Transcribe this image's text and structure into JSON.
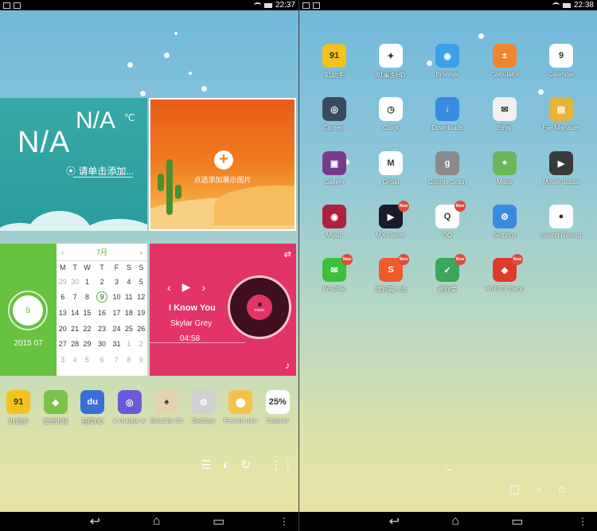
{
  "status_left": {
    "time": "22:37"
  },
  "status_right": {
    "time": "22:38"
  },
  "weather": {
    "temp_big": "N/A",
    "temp_small": "N/A",
    "unit": "℃",
    "location": "请单击添加..."
  },
  "image_widget": {
    "label": "点选添加展示图片"
  },
  "date_widget": {
    "day": "9",
    "year_month": "2015  07"
  },
  "calendar": {
    "month": "7月",
    "prev": "‹",
    "next": "›",
    "weekdays": [
      "M",
      "T",
      "W",
      "T",
      "F",
      "S",
      "S"
    ],
    "weeks": [
      [
        "29",
        "30",
        "1",
        "2",
        "3",
        "4",
        "5"
      ],
      [
        "6",
        "7",
        "8",
        "9",
        "10",
        "11",
        "12"
      ],
      [
        "13",
        "14",
        "15",
        "16",
        "17",
        "18",
        "19"
      ],
      [
        "20",
        "21",
        "22",
        "23",
        "24",
        "25",
        "26"
      ],
      [
        "27",
        "28",
        "29",
        "30",
        "31",
        "1",
        "2"
      ],
      [
        "3",
        "4",
        "5",
        "6",
        "7",
        "8",
        "9"
      ]
    ]
  },
  "music": {
    "title": "I Know You",
    "artist": "Skylar Grey",
    "time": "04:58",
    "disc_label": "music"
  },
  "dock": [
    {
      "label": "91助手",
      "color": "#f4c21c",
      "glyph": "91"
    },
    {
      "label": "安卓市场",
      "color": "#7cc24a",
      "glyph": "◆"
    },
    {
      "label": "百度HD",
      "color": "#3a6fd8",
      "glyph": "du"
    },
    {
      "label": "k change w",
      "color": "#6a5ad8",
      "glyph": "◎"
    },
    {
      "label": "Beautify Sh",
      "color": "#e4d3b0",
      "glyph": "♠"
    },
    {
      "label": "Settings",
      "color": "#d0d0d0",
      "glyph": "⚙"
    },
    {
      "label": "Recent runr",
      "color": "#f3c24a",
      "glyph": "⬤"
    },
    {
      "label": "Cleaner",
      "color": "#ffffff",
      "glyph": "25%"
    }
  ],
  "apps": [
    {
      "label": "91助手",
      "color": "#f4c21c",
      "glyph": "91",
      "new": false
    },
    {
      "label": "91桌面HD",
      "color": "#ffffff",
      "glyph": "✦",
      "new": false
    },
    {
      "label": "Browser",
      "color": "#3aa0e8",
      "glyph": "◉",
      "new": false
    },
    {
      "label": "Calculator",
      "color": "#f0862c",
      "glyph": "±",
      "new": false
    },
    {
      "label": "Calendar",
      "color": "#ffffff",
      "glyph": "9",
      "new": false
    },
    {
      "label": "Camera",
      "color": "#3a4a5c",
      "glyph": "◎",
      "new": false
    },
    {
      "label": "Clock",
      "color": "#ffffff",
      "glyph": "◷",
      "new": false
    },
    {
      "label": "Downloads",
      "color": "#3a8ae0",
      "glyph": "↓",
      "new": false
    },
    {
      "label": "Email",
      "color": "#f0f0f0",
      "glyph": "✉",
      "new": false
    },
    {
      "label": "File Manager",
      "color": "#e8b33a",
      "glyph": "▤",
      "new": false
    },
    {
      "label": "Gallery",
      "color": "#7a3a8c",
      "glyph": "▣",
      "new": false
    },
    {
      "label": "Gmail",
      "color": "#ffffff",
      "glyph": "M",
      "new": false
    },
    {
      "label": "Google Settin",
      "color": "#8a8a8a",
      "glyph": "g",
      "new": false
    },
    {
      "label": "Maps",
      "color": "#6ab85a",
      "glyph": "⌖",
      "new": false
    },
    {
      "label": "Movie Studio",
      "color": "#3a3a3a",
      "glyph": "▶",
      "new": false
    },
    {
      "label": "Music",
      "color": "#b02040",
      "glyph": "◉",
      "new": false
    },
    {
      "label": "MX Player",
      "color": "#1a1a2a",
      "glyph": "▶",
      "new": true
    },
    {
      "label": "QQ",
      "color": "#ffffff",
      "glyph": "Q",
      "new": true
    },
    {
      "label": "Settings",
      "color": "#3a8ae0",
      "glyph": "⚙",
      "new": false
    },
    {
      "label": "Sound Record",
      "color": "#ffffff",
      "glyph": "●",
      "new": false
    },
    {
      "label": "WeChat",
      "color": "#3ac23a",
      "glyph": "✉",
      "new": true
    },
    {
      "label": "搜狗输入法",
      "color": "#f25a2a",
      "glyph": "S",
      "new": true
    },
    {
      "label": "豌豆荚",
      "color": "#3aa85a",
      "glyph": "✓",
      "new": true
    },
    {
      "label": "AnTuTu Benc",
      "color": "#e03a2a",
      "glyph": "◆",
      "new": true
    }
  ],
  "badge_text": "New",
  "colors": {
    "weather": "#2a9c9c",
    "date": "#66c23f",
    "music": "#e33468"
  }
}
